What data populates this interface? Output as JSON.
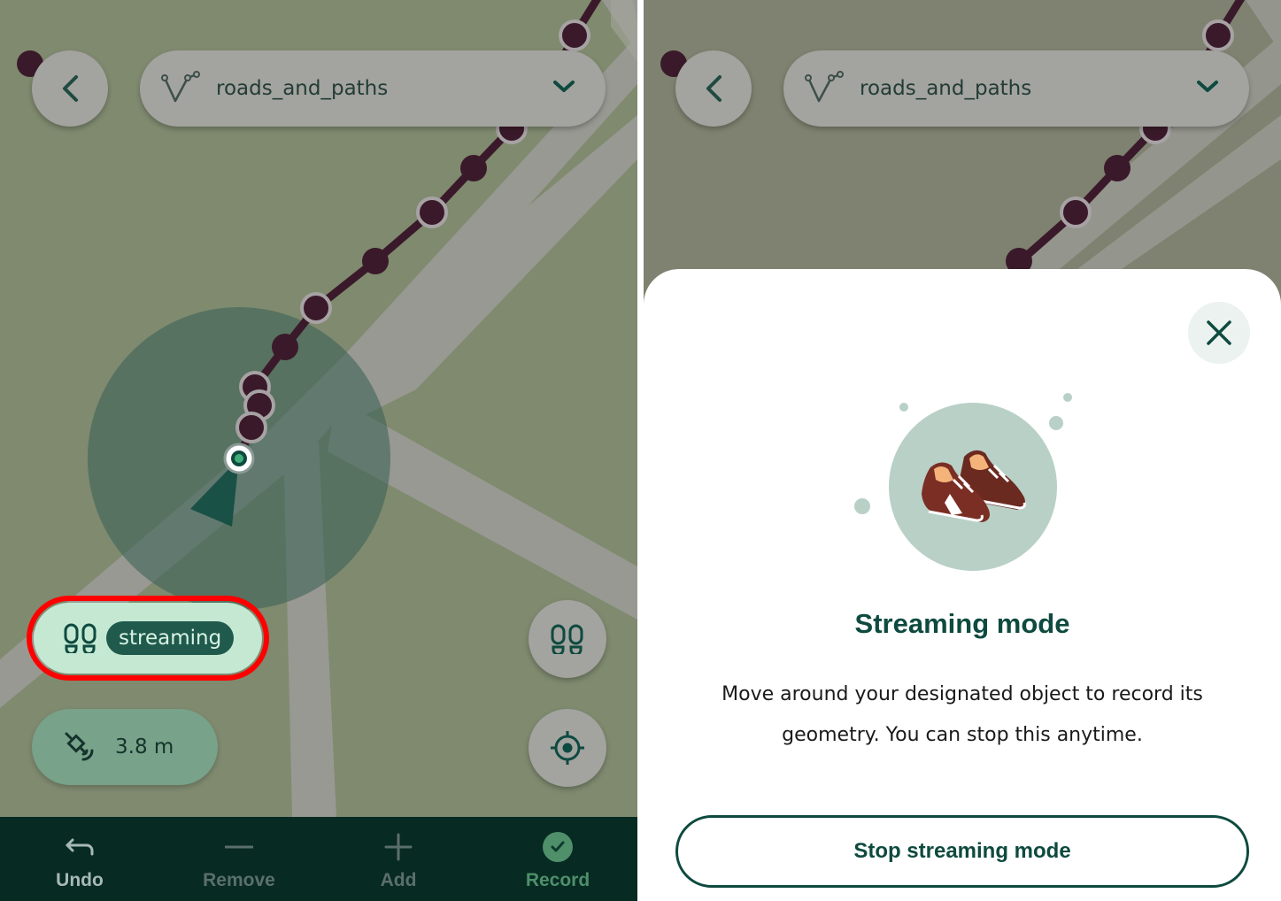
{
  "map": {
    "layer_name": "roads_and_paths"
  },
  "left": {
    "stream_badge": "streaming",
    "gps_accuracy": "3.8 m",
    "toolbar": [
      {
        "label": "Undo",
        "color": "#a7b9b4",
        "icon": "undo-icon"
      },
      {
        "label": "Remove",
        "color": "#5b6f6a",
        "icon": "minus-icon"
      },
      {
        "label": "Add",
        "color": "#5b6f6a",
        "icon": "plus-icon"
      },
      {
        "label": "Record",
        "color": "#4f8f6a",
        "icon": "check-circle-icon"
      }
    ]
  },
  "sheet": {
    "title": "Streaming mode",
    "description_line1": "Move around your designated object to record its",
    "description_line2": "geometry. You can stop this anytime.",
    "stop_button": "Stop streaming mode"
  },
  "colors": {
    "map_bg": "#7f8a6f",
    "road": "#9a9a94",
    "track": "#3a1a2a",
    "accent_dark": "#0e4a3f",
    "toolbar_bg": "#072a22",
    "highlight": "#ff0000"
  }
}
